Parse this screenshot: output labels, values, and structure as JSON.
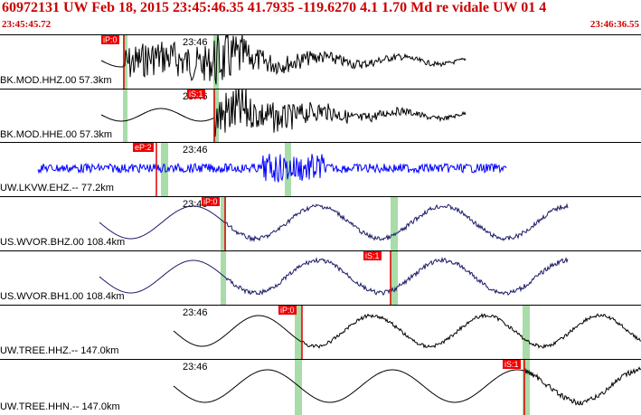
{
  "header": {
    "title": "60972131 UW Feb 18, 2015 23:45:46.35   41.7935 -119.6270  4.1 1.70 Md re vidale UW 01   4",
    "start_time": "23:45:45.72",
    "end_time": "23:46:36.55"
  },
  "colors": {
    "header_text": "#cc0000",
    "pick_box": "#ee0000",
    "window_band": "#a8dca8",
    "trace_default": "#000000",
    "trace_blue": "#0000ff",
    "trace_navy": "#1a1a66"
  },
  "traces": [
    {
      "label": "BK.MOD.HHZ.00 57.3km",
      "time": "23:46",
      "pick": "iP:0"
    },
    {
      "label": "BK.MOD.HHE.00 57.3km",
      "time": "23:46",
      "pick": "iS:1"
    },
    {
      "label": "UW.LKVW.EHZ.-- 77.2km",
      "time": "23:46",
      "pick": "eP:2"
    },
    {
      "label": "US.WVOR.BHZ.00 108.4km",
      "time": "23:46",
      "pick": "iP:0"
    },
    {
      "label": "US.WVOR.BH1.00 108.4km",
      "time": "",
      "pick": "iS:1"
    },
    {
      "label": "UW.TREE.HHZ.-- 147.0km",
      "time": "23:46",
      "pick": "iP:0"
    },
    {
      "label": "UW.TREE.HHN.-- 147.0km",
      "time": "23:46",
      "pick": "iS:1"
    }
  ]
}
